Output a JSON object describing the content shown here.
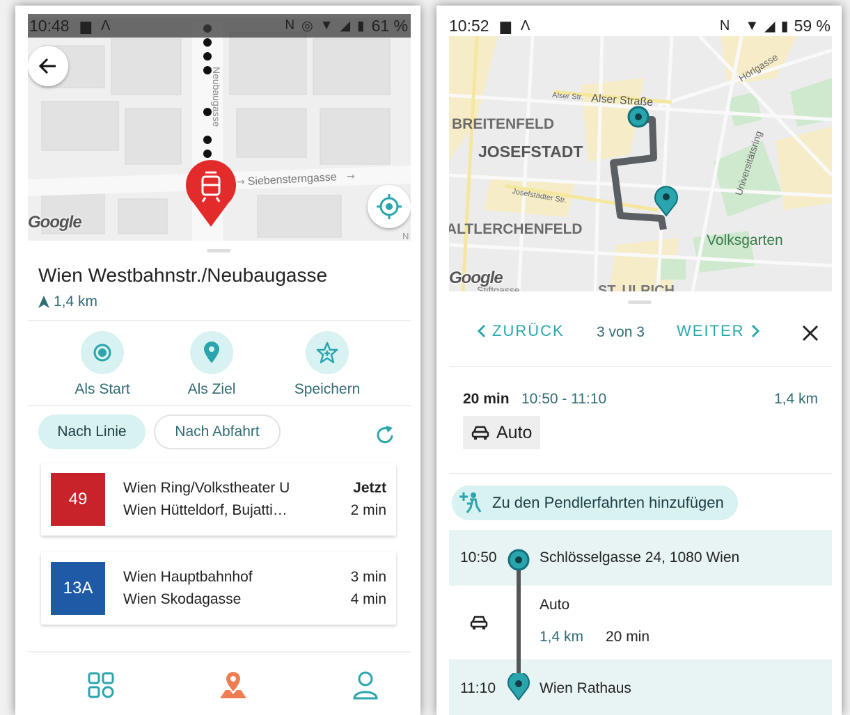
{
  "left": {
    "status": {
      "time": "10:48",
      "battery": "61 %"
    },
    "map": {
      "street_vertical": "Neubaugasse",
      "street_horizontal": "Siebensterngasse",
      "logo": "Google",
      "corner_letter": "N"
    },
    "stop": {
      "name": "Wien Westbahnstr./Neubaugasse",
      "distance": "1,4 km"
    },
    "actions": [
      {
        "label": "Als Start",
        "icon": "target-icon"
      },
      {
        "label": "Als Ziel",
        "icon": "pin-icon"
      },
      {
        "label": "Speichern",
        "icon": "star-plus-icon"
      }
    ],
    "filters": {
      "by_line": "Nach Linie",
      "by_departure": "Nach Abfahrt"
    },
    "departures": [
      {
        "line": "49",
        "color": "#c8222a",
        "dest1": "Wien Ring/Volkstheater U",
        "dest2": "Wien Hütteldorf, Bujatti…",
        "time1": "Jetzt",
        "time2": "2 min"
      },
      {
        "line": "13A",
        "color": "#1f5aa6",
        "dest1": "Wien Hauptbahnhof",
        "dest2": "Wien Skodagasse",
        "time1": "3 min",
        "time2": "4 min"
      }
    ]
  },
  "right": {
    "status": {
      "time": "10:52",
      "battery": "59 %"
    },
    "map": {
      "labels": {
        "hoerlgasse": "Hörlgasse",
        "alser_small": "Alser Str.",
        "alser": "Alser Straße",
        "breitenfeld": "BREITENFELD",
        "josefstadt": "JOSEFSTADT",
        "josefstaedter": "Josefstädter Str.",
        "universitaetsring": "Universitätsring",
        "altlerchenfeld": "ALTLERCHENFELD",
        "volksgarten": "Volksgarten",
        "stiftgasse": "Stiftgasse",
        "st_ulrich": "ST. ULRICH"
      },
      "logo": "Google"
    },
    "pager": {
      "prev": "ZURÜCK",
      "count": "3 von 3",
      "next": "WEITER"
    },
    "summary": {
      "duration": "20 min",
      "time_range": "10:50 - 11:10",
      "distance": "1,4 km",
      "mode": "Auto"
    },
    "commute_button": "Zu den Pendlerfahrten hinzufügen",
    "itinerary": {
      "start": {
        "time": "10:50",
        "name": "Schlösselgasse 24, 1080 Wien"
      },
      "segment": {
        "mode": "Auto",
        "distance": "1,4 km",
        "duration": "20 min"
      },
      "end": {
        "time": "11:10",
        "name": "Wien Rathaus"
      }
    }
  },
  "colors": {
    "teal": "#2aa5ad",
    "teal_light": "#d8f1f1",
    "pin_red": "#e32b2b",
    "nav_orange": "#f07c52"
  }
}
